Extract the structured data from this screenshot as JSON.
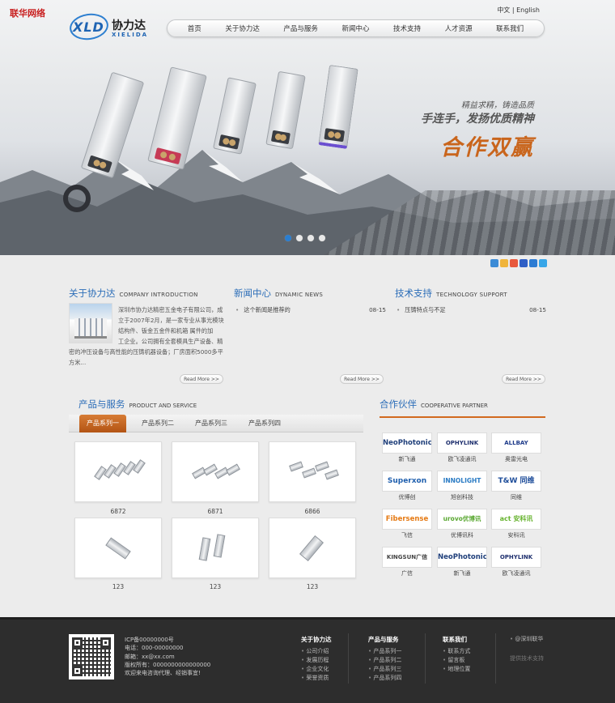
{
  "site": {
    "corner_brand": "联华网络",
    "logo": {
      "abbr": "XLD",
      "cn": "协力达",
      "en": "XIELIDA"
    },
    "lang": {
      "cn": "中文",
      "sep": "|",
      "en": "English"
    }
  },
  "nav": [
    "首页",
    "关于协力达",
    "产品与服务",
    "新闻中心",
    "技术支持",
    "人才资源",
    "联系我们"
  ],
  "banner": {
    "slogan1": "精益求精，铸造品质",
    "slogan2": "手连手，发扬优质精神",
    "slogan3": "合作双赢",
    "slides": 4,
    "active_slide": 1
  },
  "share_icons": [
    "qzone-icon",
    "star-icon",
    "tencent-icon",
    "baidu-icon",
    "renren-icon",
    "qq-icon"
  ],
  "about": {
    "title": "关于协力达",
    "title_en": "COMPANY INTRODUCTION",
    "lines": [
      "深圳市协力达精密五金电子有限公司，成",
      "立于2007年2月，是一家专业从事光模块",
      "结构件、钣金五金件和机箱 属件的加",
      "工企业。公司拥有全套模具生产设备、精",
      "密的冲压设备与高性能的压铸机器设备；厂房面积5000多平",
      "方米..."
    ],
    "more": "Read More >>"
  },
  "news": {
    "title": "新闻中心",
    "title_en": "DYNAMIC NEWS",
    "items": [
      {
        "title": "这个新闻是推荐的",
        "date": "08-15"
      }
    ],
    "more": "Read More >>"
  },
  "support": {
    "title": "技术支持",
    "title_en": "TECHNOLOGY SUPPORT",
    "items": [
      {
        "title": "压铸特点与不足",
        "date": "08-15"
      }
    ],
    "more": "Read More >>"
  },
  "products": {
    "title": "产品与服务",
    "title_en": "PRODUCT AND SERVICE",
    "tabs": [
      "产品系列一",
      "产品系列二",
      "产品系列三",
      "产品系列四"
    ],
    "active_tab": 0,
    "items": [
      "6872",
      "6871",
      "6866",
      "123",
      "123",
      "123"
    ]
  },
  "partners": {
    "title": "合作伙伴",
    "title_en": "COOPERATIVE PARTNER",
    "items": [
      {
        "logo": "NeoPhotonics",
        "name": "新飞通",
        "color": "#1f3f7a"
      },
      {
        "logo": "OPHYLINK",
        "name": "欧飞凌通讯",
        "color": "#1e2f6e"
      },
      {
        "logo": "ALLBAY",
        "name": "奥雷光电",
        "color": "#1e3b8a"
      },
      {
        "logo": "Superxon",
        "name": "优博创",
        "color": "#1f5fae"
      },
      {
        "logo": "INNOLIGHT",
        "name": "旭创科技",
        "color": "#2a7bc4"
      },
      {
        "logo": "T&W 同维",
        "name": "同维",
        "color": "#1e4d9a"
      },
      {
        "logo": "Fibersense",
        "name": "飞信",
        "color": "#e57a14"
      },
      {
        "logo": "urovo优博讯",
        "name": "优博讯科",
        "color": "#5aa832"
      },
      {
        "logo": "act 安科讯",
        "name": "安科讯",
        "color": "#66b32e"
      },
      {
        "logo": "KINGSUN广信",
        "name": "广信",
        "color": "#444444"
      },
      {
        "logo": "NeoPhotonics",
        "name": "新飞通",
        "color": "#1f3f7a"
      },
      {
        "logo": "OPHYLINK",
        "name": "欧飞凌通讯",
        "color": "#1e2f6e"
      }
    ]
  },
  "footer": {
    "info": [
      "ICP备00000000号",
      "电话：000-00000000",
      "邮箱：xx@xx.com",
      "版权所有：0000000000000000",
      "欢迎来电咨询代理、经销事宜!"
    ],
    "columns": [
      {
        "title": "关于协力达",
        "links": [
          "公司介绍",
          "发展历程",
          "企业文化",
          "荣誉资质"
        ]
      },
      {
        "title": "产品与服务",
        "links": [
          "产品系列一",
          "产品系列二",
          "产品系列三",
          "产品系列四"
        ]
      },
      {
        "title": "联系我们",
        "links": [
          "联系方式",
          "留言板",
          "地理位置"
        ]
      }
    ],
    "brand": "@深圳联华",
    "brand_sub": "提供技术支持"
  },
  "colors": {
    "accent_blue": "#2b6db8",
    "accent_orange": "#d26a1f",
    "footer_bg": "#2d2d2d"
  }
}
